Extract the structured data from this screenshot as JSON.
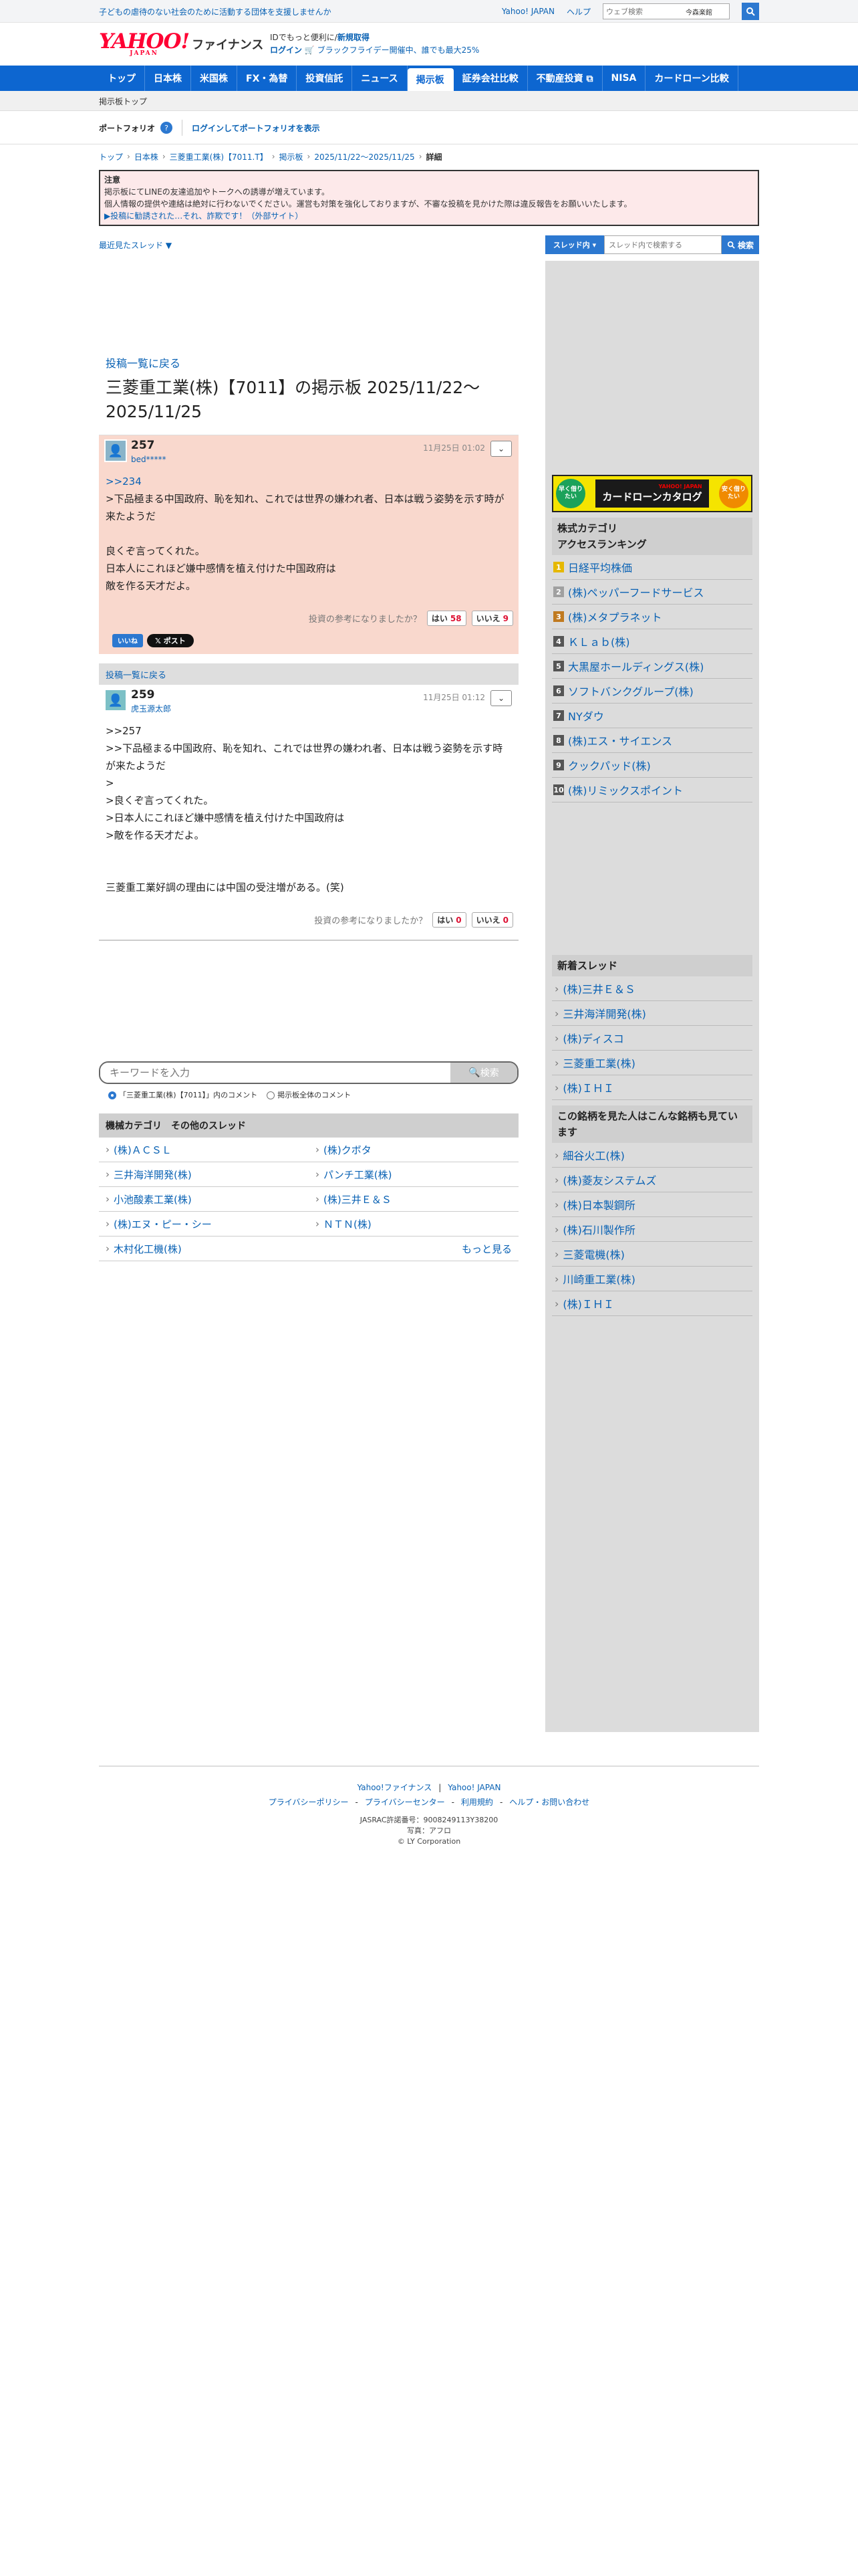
{
  "topstrip": {
    "campaign": "子どもの虐待のない社会のために活動する団体を支援しませんか",
    "links": [
      "Yahoo! JAPAN",
      "ヘルプ"
    ],
    "search_placeholder": "ウェブ検索",
    "search_mark": "今森楽館"
  },
  "header": {
    "logo": "YAHOO!",
    "logo_sub": "JAPAN",
    "brand": "ファイナンス",
    "msg1_prefix": "IDでもっと便利に",
    "msg1_link": "新規取得",
    "msg2_link": "ログイン",
    "msg2_text": "ブラックフライデー開催中、誰でも最大25%"
  },
  "nav": {
    "items": [
      "トップ",
      "日本株",
      "米国株",
      "FX・為替",
      "投資信託",
      "ニュース",
      "掲示板",
      "証券会社比較",
      "不動産投資 ⧉",
      "NISA",
      "カードローン比較"
    ],
    "active": 6
  },
  "subnav": {
    "label": "掲示板トップ"
  },
  "portfolio": {
    "label": "ポートフォリオ",
    "help": "?",
    "login_link": "ログインしてポートフォリオを表示"
  },
  "breadcrumb": [
    "トップ",
    "日本株",
    "三菱重工業(株)【7011.T】",
    "掲示板",
    "2025/11/22〜2025/11/25",
    "詳細"
  ],
  "notice": {
    "title": "注意",
    "line1": "掲示板にてLINEの友達追加やトークへの誘導が増えています。",
    "line2": "個人情報の提供や連絡は絶対に行わないでください。運営も対策を強化しておりますが、不審な投稿を見かけた際は違反報告をお願いいたします。",
    "link": "▶投稿に勧誘された…それ、詐欺です！（外部サイト）"
  },
  "threadbar": {
    "recent": "最近見たスレッド ▼",
    "scope": "スレッド内 ▾",
    "placeholder": "スレッド内で検索する",
    "button": "検索"
  },
  "main": {
    "back_link": "投稿一覧に戻る",
    "title": "三菱重工業(株)【7011】の掲示板 2025/11/22〜2025/11/25",
    "posts": [
      {
        "num": "257",
        "user": "bed*****",
        "date": "11月25日 01:02",
        "reply": ">>234",
        "body": ">下品極まる中国政府、恥を知れ、これでは世界の嫌われ者、日本は戦う姿勢を示す時が来たようだ\n\n良くぞ言ってくれた。\n日本人にこれほど嫌中感情を植え付けた中国政府は\n敵を作る天才だよ。",
        "vote_q": "投資の参考になりましたか？",
        "yes": "はい",
        "yes_n": "58",
        "no": "いいえ",
        "no_n": "9"
      },
      {
        "num": "259",
        "user": "虎玉源太郎",
        "date": "11月25日 01:12",
        "body": ">>257\n>>下品極まる中国政府、恥を知れ、これでは世界の嫌われ者、日本は戦う姿勢を示す時が来たようだ\n>\n>良くぞ言ってくれた。\n>日本人にこれほど嫌中感情を植え付けた中国政府は\n>敵を作る天才だよ。\n\n\n三菱重工業好調の理由には中国の受注増がある。(笑)",
        "vote_q": "投資の参考になりましたか？",
        "yes": "はい",
        "yes_n": "0",
        "no": "いいえ",
        "no_n": "0"
      }
    ],
    "share_fb": "いいね",
    "share_x": "ポスト",
    "back_bar": "投稿一覧に戻る",
    "keyword_placeholder": "キーワードを入力",
    "keyword_button": "検索",
    "radio1": "「三菱重工業(株)【7011】」内のコメント",
    "radio2": "掲示板全体のコメント",
    "other_head": "機械カテゴリ　その他のスレッド",
    "other": [
      "(株)ＡＣＳＬ",
      "(株)クボタ",
      "三井海洋開発(株)",
      "パンチ工業(株)",
      "小池酸素工業(株)",
      "(株)三井Ｅ＆Ｓ",
      "(株)エヌ・ピー・シー",
      "ＮＴＮ(株)",
      "木村化工機(株)",
      "もっと見る"
    ]
  },
  "side": {
    "banner_l": "早く借りたい",
    "banner_mid": "カードローンカタログ",
    "banner_mid_small": "YAHOO! JAPAN",
    "banner_r": "安く借りたい",
    "rank_head": "株式カテゴリ\nアクセスランキング",
    "ranks": [
      "日経平均株価",
      "(株)ペッパーフードサービス",
      "(株)メタプラネット",
      "ＫＬａｂ(株)",
      "大黒屋ホールディングス(株)",
      "ソフトバンクグループ(株)",
      "NYダウ",
      "(株)エス・サイエンス",
      "クックパッド(株)",
      "(株)リミックスポイント"
    ],
    "new_head": "新着スレッド",
    "new": [
      "(株)三井Ｅ＆Ｓ",
      "三井海洋開発(株)",
      "(株)ディスコ",
      "三菱重工業(株)",
      "(株)ＩＨＩ"
    ],
    "also_head": "この銘柄を見た人はこんな銘柄も見ています",
    "also": [
      "細谷火工(株)",
      "(株)菱友システムズ",
      "(株)日本製鋼所",
      "(株)石川製作所",
      "三菱電機(株)",
      "川崎重工業(株)",
      "(株)ＩＨＩ"
    ]
  },
  "footer": {
    "links1": [
      "Yahoo!ファイナンス",
      "|",
      "Yahoo! JAPAN"
    ],
    "links2": [
      "プライバシーポリシー",
      "-",
      "プライバシーセンター",
      "-",
      "利用規約",
      "-",
      "ヘルプ・お問い合わせ"
    ],
    "jasrac": "JASRAC許諾番号：9008249113Y38200",
    "photo": "写真：アフロ",
    "copy": "© LY Corporation"
  },
  "colors": {
    "nav": "#0d66d0",
    "link": "#0a62b4",
    "highlight_post": "#f9d8cd",
    "notice_bg": "#fde9ea"
  }
}
